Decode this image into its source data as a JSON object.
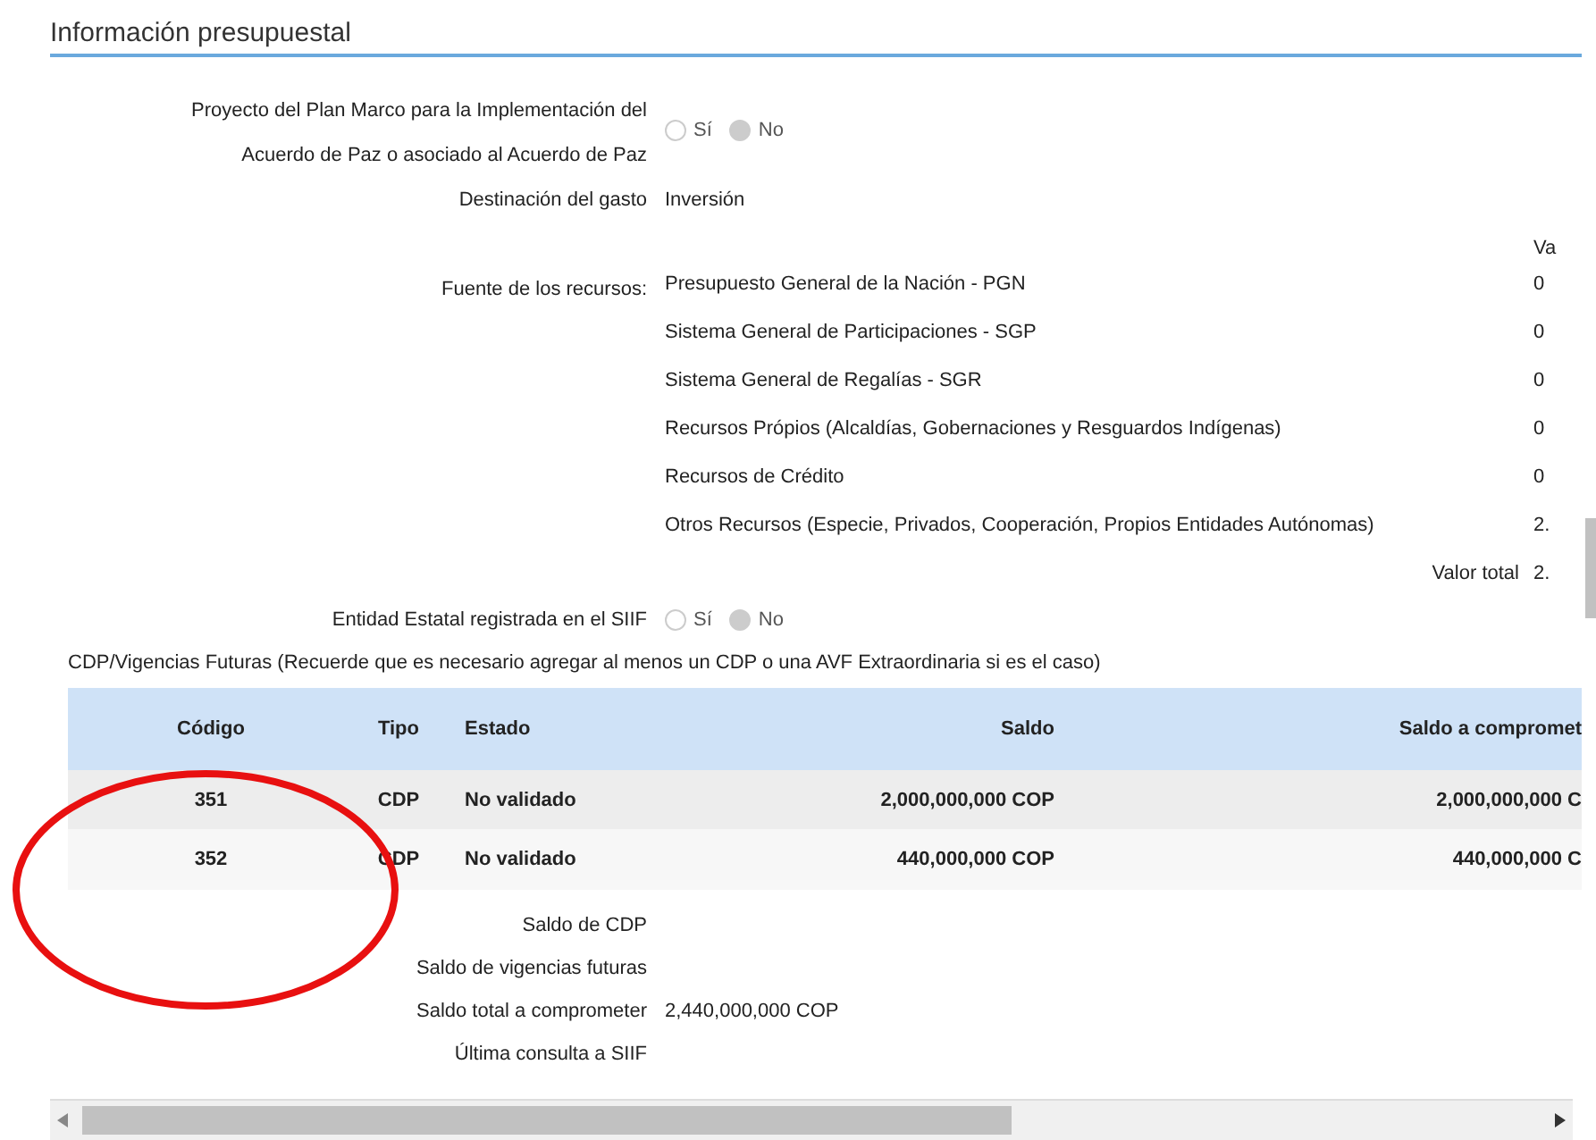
{
  "section_title": "Información presupuestal",
  "fields": [
    {
      "kind": "radio",
      "label": "Proyecto del Plan Marco para la Implementación del Acuerdo de Paz o asociado al Acuerdo de Paz",
      "options": [
        {
          "label": "Sí",
          "selected": false
        },
        {
          "label": "No",
          "selected": true
        }
      ]
    },
    {
      "kind": "text",
      "label": "Destinación del gasto",
      "value": "Inversión"
    },
    {
      "kind": "sources",
      "label": "Fuente de los recursos:",
      "value_header": "Va",
      "items": [
        {
          "name": "Presupuesto General de la Nación - PGN",
          "value": "0"
        },
        {
          "name": "Sistema General de Participaciones - SGP",
          "value": "0"
        },
        {
          "name": "Sistema General de Regalías - SGR",
          "value": "0"
        },
        {
          "name": "Recursos Própios (Alcaldías, Gobernaciones y Resguardos Indígenas)",
          "value": "0"
        },
        {
          "name": "Recursos de Crédito",
          "value": "0"
        },
        {
          "name": "Otros Recursos (Especie, Privados, Cooperación, Propios Entidades Autónomas)",
          "value": "2."
        }
      ],
      "total_label": "Valor total",
      "total_value": "2."
    },
    {
      "kind": "radio",
      "label": "Entidad Estatal registrada en el SIIF",
      "options": [
        {
          "label": "Sí",
          "selected": false
        },
        {
          "label": "No",
          "selected": true
        }
      ]
    }
  ],
  "cdp_note": "CDP/Vigencias Futuras (Recuerde que es necesario agregar al menos un CDP o una AVF Extraordinaria si es el caso)",
  "table": {
    "columns": [
      "Código",
      "Tipo",
      "Estado",
      "Saldo",
      "Saldo a compromet"
    ],
    "rows": [
      [
        "351",
        "CDP",
        "No validado",
        "2,000,000,000 COP",
        "2,000,000,000 C"
      ],
      [
        "352",
        "CDP",
        "No validado",
        "440,000,000 COP",
        "440,000,000 C"
      ]
    ]
  },
  "summary": [
    {
      "label": "Saldo de CDP"
    },
    {
      "label": "Saldo de vigencias futuras"
    },
    {
      "label": "Saldo total a comprometer",
      "value": "2,440,000,000 COP"
    },
    {
      "label": "Última consulta a SIIF"
    }
  ]
}
